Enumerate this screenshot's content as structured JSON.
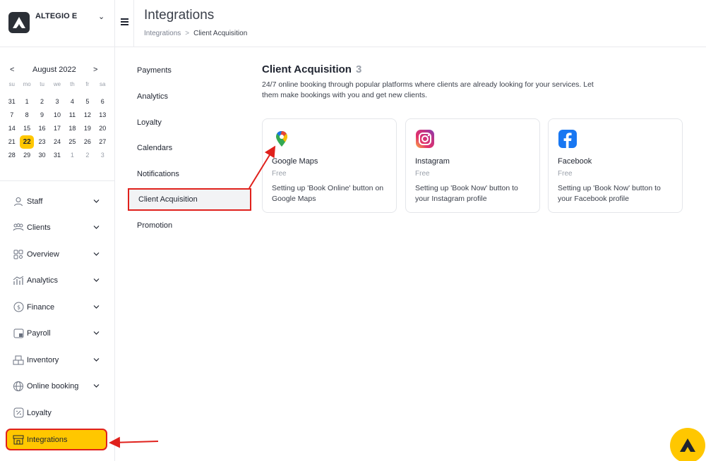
{
  "brand": {
    "name": "ALTEGIO E",
    "logo_icon": "altegio-logo-icon"
  },
  "calendar": {
    "prev": "<",
    "month": "August 2022",
    "next": ">",
    "weekdays": [
      "su",
      "mo",
      "tu",
      "we",
      "th",
      "fr",
      "sa"
    ],
    "days": [
      {
        "d": "31",
        "muted": false
      },
      {
        "d": "1",
        "muted": false
      },
      {
        "d": "2",
        "muted": false
      },
      {
        "d": "3",
        "muted": false
      },
      {
        "d": "4",
        "muted": false
      },
      {
        "d": "5",
        "muted": false
      },
      {
        "d": "6",
        "muted": false
      },
      {
        "d": "7",
        "muted": false
      },
      {
        "d": "8",
        "muted": false
      },
      {
        "d": "9",
        "muted": false
      },
      {
        "d": "10",
        "muted": false
      },
      {
        "d": "11",
        "muted": false
      },
      {
        "d": "12",
        "muted": false
      },
      {
        "d": "13",
        "muted": false
      },
      {
        "d": "14",
        "muted": false
      },
      {
        "d": "15",
        "muted": false
      },
      {
        "d": "16",
        "muted": false
      },
      {
        "d": "17",
        "muted": false
      },
      {
        "d": "18",
        "muted": false
      },
      {
        "d": "19",
        "muted": false
      },
      {
        "d": "20",
        "muted": false
      },
      {
        "d": "21",
        "muted": false
      },
      {
        "d": "22",
        "today": true
      },
      {
        "d": "23",
        "muted": false
      },
      {
        "d": "24",
        "muted": false
      },
      {
        "d": "25",
        "muted": false
      },
      {
        "d": "26",
        "muted": false
      },
      {
        "d": "27",
        "muted": false
      },
      {
        "d": "28",
        "muted": false
      },
      {
        "d": "29",
        "muted": false
      },
      {
        "d": "30",
        "muted": false
      },
      {
        "d": "31",
        "muted": false
      },
      {
        "d": "1",
        "muted": true
      },
      {
        "d": "2",
        "muted": true
      },
      {
        "d": "3",
        "muted": true
      }
    ]
  },
  "sidebar": {
    "items": [
      {
        "label": "Staff",
        "icon": "person-icon",
        "has_chevron": true
      },
      {
        "label": "Clients",
        "icon": "people-icon",
        "has_chevron": true
      },
      {
        "label": "Overview",
        "icon": "grid-search-icon",
        "has_chevron": true
      },
      {
        "label": "Analytics",
        "icon": "bar-chart-icon",
        "has_chevron": true
      },
      {
        "label": "Finance",
        "icon": "dollar-circle-icon",
        "has_chevron": true
      },
      {
        "label": "Payroll",
        "icon": "payroll-icon",
        "has_chevron": true
      },
      {
        "label": "Inventory",
        "icon": "boxes-icon",
        "has_chevron": true
      },
      {
        "label": "Online booking",
        "icon": "globe-icon",
        "has_chevron": true
      },
      {
        "label": "Loyalty",
        "icon": "percent-icon",
        "has_chevron": false
      },
      {
        "label": "Integrations",
        "icon": "store-icon",
        "has_chevron": false,
        "active": true
      }
    ]
  },
  "header": {
    "title": "Integrations",
    "breadcrumb": {
      "root": "Integrations",
      "separator": ">",
      "current": "Client Acquisition"
    }
  },
  "subnav": {
    "items": [
      {
        "label": "Payments"
      },
      {
        "label": "Analytics"
      },
      {
        "label": "Loyalty"
      },
      {
        "label": "Calendars"
      },
      {
        "label": "Notifications"
      },
      {
        "label": "Client Acquisition",
        "active": true
      },
      {
        "label": "Promotion"
      }
    ]
  },
  "section": {
    "title": "Client Acquisition",
    "count": "3",
    "description": "24/7 online booking through popular platforms where clients are already looking for your services. Let them make bookings with you and get new clients."
  },
  "cards": [
    {
      "name": "Google Maps",
      "price": "Free",
      "description": "Setting up 'Book Online' button on Google Maps",
      "icon": "google-maps-pin-icon"
    },
    {
      "name": "Instagram",
      "price": "Free",
      "description": "Setting up 'Book Now' button to your Instagram profile",
      "icon": "instagram-icon"
    },
    {
      "name": "Facebook",
      "price": "Free",
      "description": "Setting up 'Book Now' button to your Facebook profile",
      "icon": "facebook-icon"
    }
  ],
  "colors": {
    "accent": "#ffc700",
    "annotation": "#e0211c",
    "facebook": "#1877f2"
  }
}
